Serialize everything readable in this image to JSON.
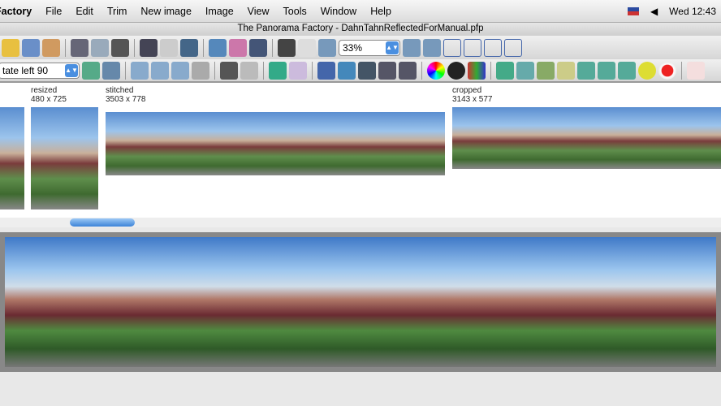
{
  "menubar": {
    "app": "Factory",
    "items": [
      "File",
      "Edit",
      "Trim",
      "New image",
      "Image",
      "View",
      "Tools",
      "Window",
      "Help"
    ],
    "clock": "Wed 12:43"
  },
  "title": "The Panorama Factory - DahnTahnReflectedForManual.pfp",
  "toolbar": {
    "zoom": "33%",
    "transform": "tate left 90"
  },
  "thumbnails": [
    {
      "name": "",
      "size": ""
    },
    {
      "name": "resized",
      "size": "480 x 725"
    },
    {
      "name": "stitched",
      "size": "3503 x 778"
    },
    {
      "name": "cropped",
      "size": "3143 x 577"
    }
  ]
}
